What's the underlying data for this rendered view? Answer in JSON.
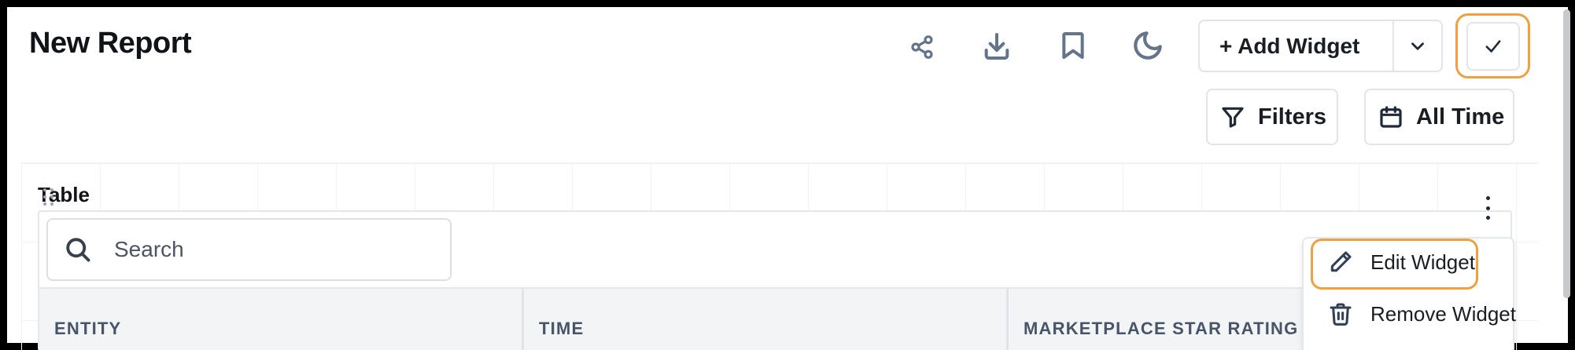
{
  "header": {
    "title": "New Report",
    "icons": [
      "share-icon",
      "download-icon",
      "bookmark-icon",
      "moon-icon"
    ],
    "add_widget_label": "+ Add Widget",
    "done_icon": "check-icon"
  },
  "filters_bar": {
    "filters_label": "Filters",
    "time_label": "All Time"
  },
  "widget": {
    "title": "Table",
    "search_placeholder": "Search",
    "columns": [
      "ENTITY",
      "TIME",
      "MARKETPLACE STAR RATING"
    ]
  },
  "widget_menu": {
    "items": [
      {
        "label": "Edit Widget",
        "icon": "pencil-icon"
      },
      {
        "label": "Remove Widget",
        "icon": "trash-icon"
      }
    ]
  },
  "colors": {
    "highlight": "#f0a040",
    "icon_gray": "#64748b"
  }
}
